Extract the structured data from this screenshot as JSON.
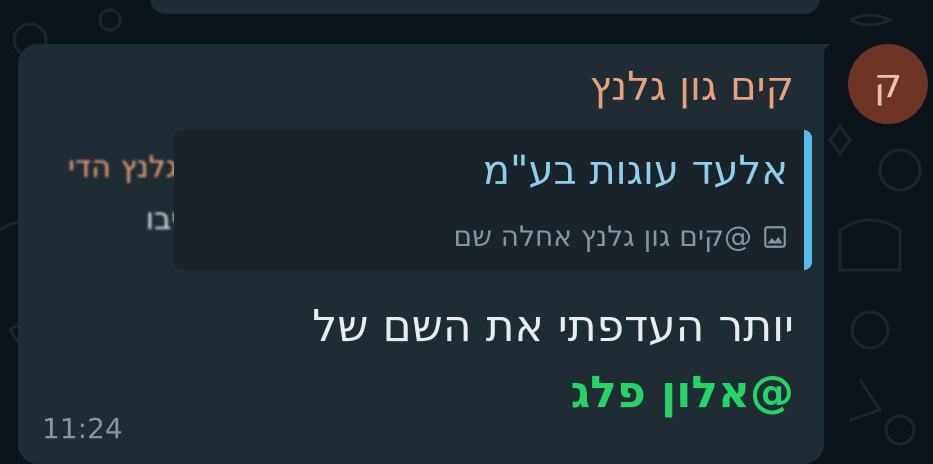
{
  "colors": {
    "background": "#0b141a",
    "bubble": "#1f2c34",
    "quote_background": "#1a2329",
    "quote_bar": "#53bdeb",
    "sender_name": "#e9a17c",
    "quote_title": "#8ecfee",
    "mention": "#25d366",
    "avatar_background": "#6e3524",
    "meta_text": "#8696a0"
  },
  "avatar": {
    "initial": "ק"
  },
  "message": {
    "sender": "קים גון גלנץ",
    "quote": {
      "title": "אלעד עוגות בע\"מ",
      "icon": "photo-icon",
      "subtitle": "@קים גון גלנץ אחלה שם"
    },
    "text": "יותר העדפתי את השם של",
    "mention": "@אלון פלג",
    "time": "11:24"
  },
  "blurred_preview": {
    "line1": "גלנץ הדי",
    "line2": "יבו"
  }
}
